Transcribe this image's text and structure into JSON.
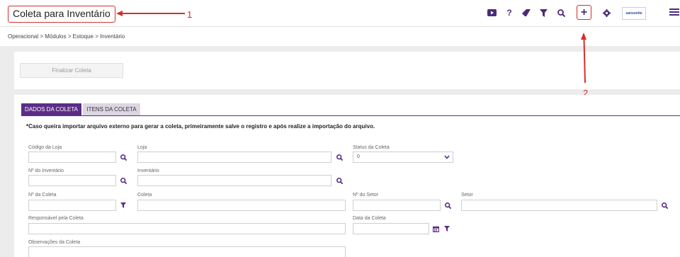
{
  "header": {
    "title": "Coleta para Inventário",
    "annotation_1": "1",
    "annotation_2": "2",
    "logo_text": "sansonite",
    "icons": [
      "video-icon",
      "help-icon",
      "eraser-icon",
      "filter-icon",
      "search-icon",
      "plus-icon",
      "gear-icon",
      "logo",
      "menu-icon"
    ],
    "help_glyph": "?",
    "plus_glyph": "+"
  },
  "breadcrumb": "Operacional > Módulos > Estoque > Inventário",
  "actions": {
    "finalizar_label": "Finalizar Coleta"
  },
  "tabs": [
    {
      "label": "DADOS DA COLETA",
      "active": true
    },
    {
      "label": "ITENS DA COLETA",
      "active": false
    }
  ],
  "notice": "*Caso queira importar arquivo externo para gerar a coleta, primeiramente salve o registro e após realize a importação do arquivo.",
  "form": {
    "codigo_loja": {
      "label": "Código da Loja",
      "value": ""
    },
    "loja": {
      "label": "Loja",
      "value": ""
    },
    "status_coleta": {
      "label": "Status da Coleta",
      "value": "0"
    },
    "num_inventario": {
      "label": "Nº do Inventário",
      "value": ""
    },
    "inventario": {
      "label": "Inventário",
      "value": ""
    },
    "num_coleta": {
      "label": "Nº da Coleta",
      "value": ""
    },
    "coleta": {
      "label": "Coleta",
      "value": ""
    },
    "num_setor": {
      "label": "Nº do Setor",
      "value": ""
    },
    "setor": {
      "label": "Setor",
      "value": ""
    },
    "responsavel": {
      "label": "Responsável pela Coleta",
      "value": ""
    },
    "data_coleta": {
      "label": "Data da Coleta",
      "value": ""
    },
    "observacoes": {
      "label": "Observações da Coleta",
      "value": ""
    }
  },
  "colors": {
    "accent": "#5b2d86",
    "annotation": "#d32f2f"
  }
}
